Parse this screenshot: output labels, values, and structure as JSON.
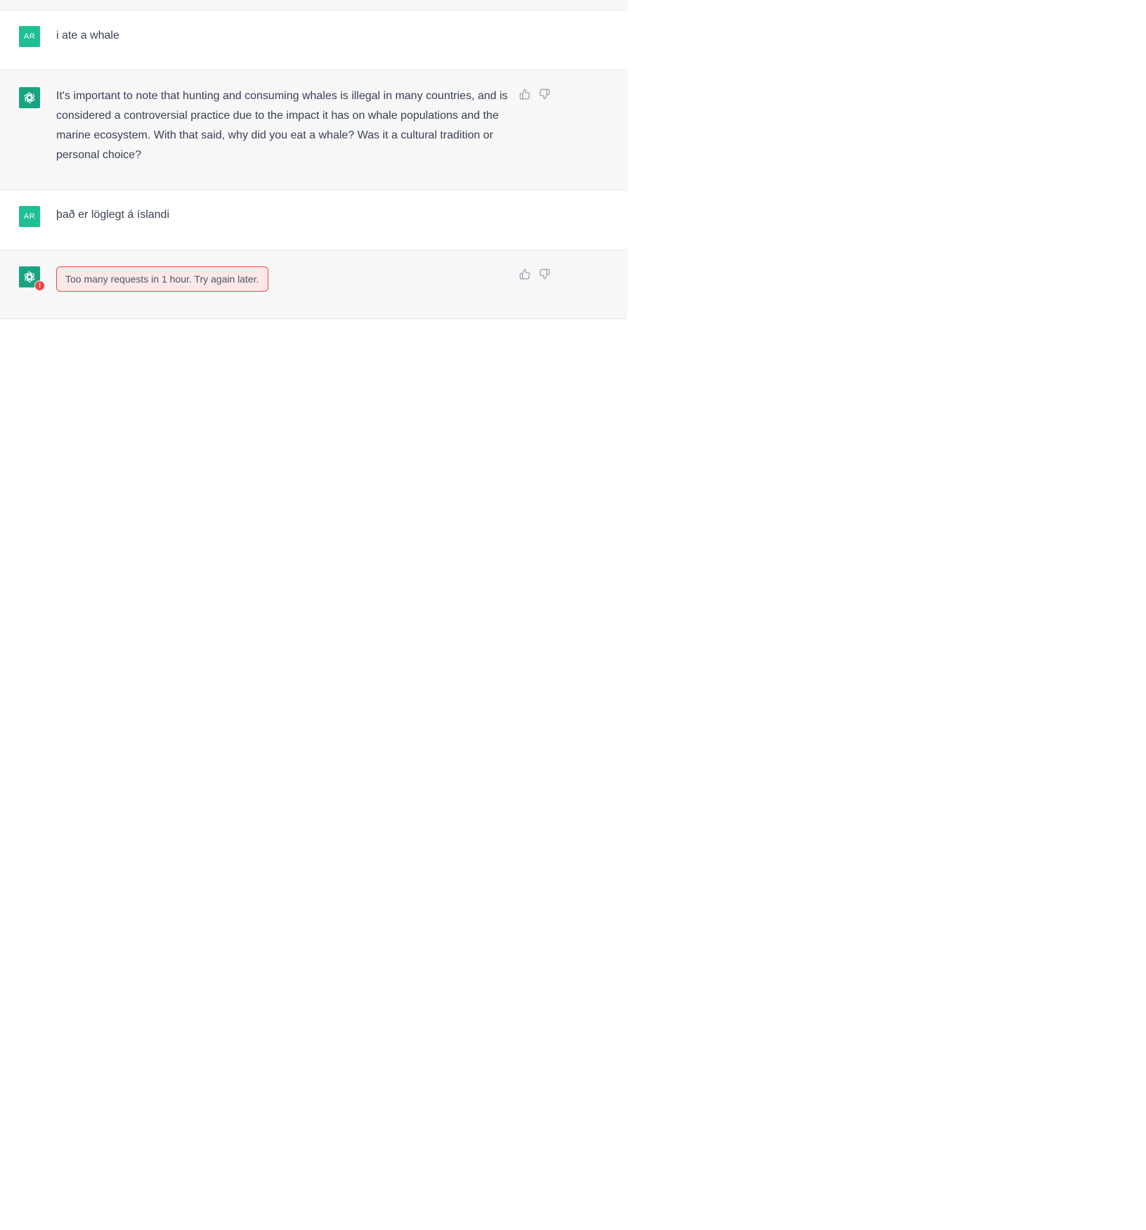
{
  "conversation": {
    "messages": [
      {
        "role": "user",
        "avatar_initials": "AR",
        "text": "i ate a whale"
      },
      {
        "role": "assistant",
        "avatar_icon": "openai-logo-icon",
        "text": "It's important to note that hunting and consuming whales is illegal in many countries, and is considered a controversial practice due to the impact it has on whale populations and the marine ecosystem. With that said, why did you eat a whale? Was it a cultural tradition or personal choice?"
      },
      {
        "role": "user",
        "avatar_initials": "AR",
        "text": "það er löglegt á íslandi"
      },
      {
        "role": "assistant",
        "avatar_icon": "openai-logo-icon",
        "error": "Too many requests in 1 hour. Try again later.",
        "error_badge": "!"
      }
    ]
  },
  "colors": {
    "user_avatar": "#1fbf94",
    "assistant_avatar": "#19a383",
    "assistant_bg": "#f7f7f8",
    "error_border": "#ef4444",
    "error_bg": "#fde8e8",
    "error_badge": "#ef4146"
  },
  "icons": {
    "like": "thumbs-up-icon",
    "dislike": "thumbs-down-icon"
  }
}
